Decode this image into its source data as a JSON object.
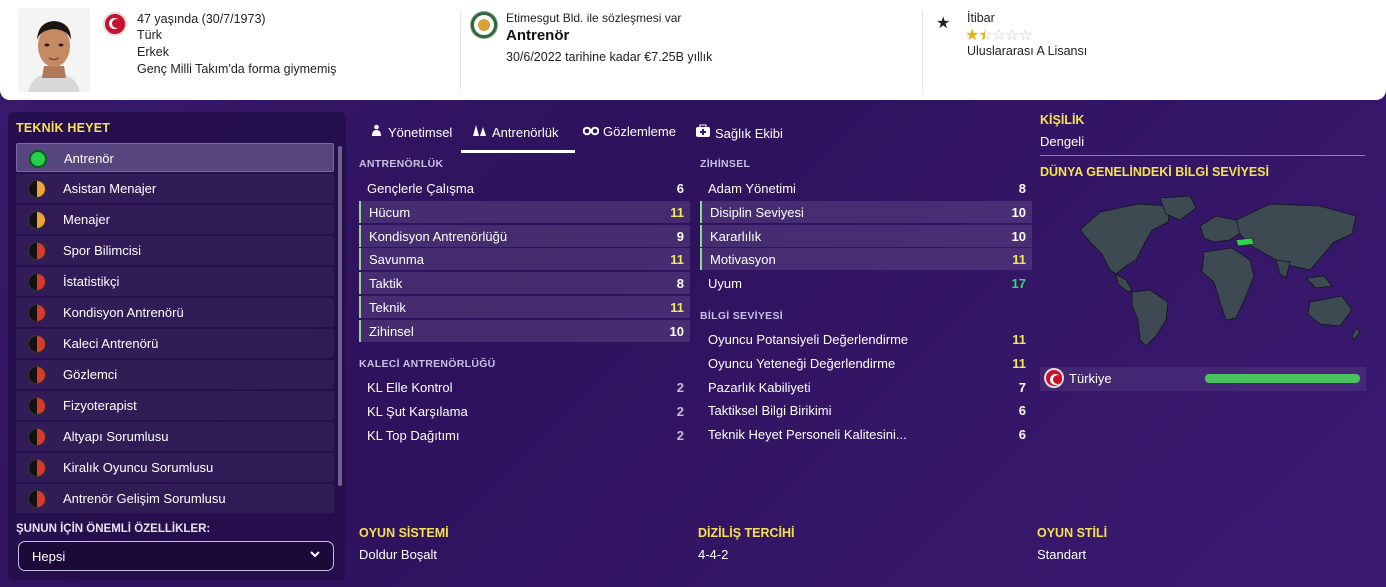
{
  "header": {
    "age_line": "47 yaşında (30/7/1973)",
    "nationality": "Türk",
    "gender": "Erkek",
    "caps_line": "Genç Milli Takım'da forma giymemiş",
    "contract_line": "Etimesgut Bld. ile sözleşmesi var",
    "role": "Antrenör",
    "contract_detail": "30/6/2022 tarihine kadar €7.25B yıllık",
    "reputation_label": "İtibar",
    "reputation_stars": 1.5,
    "reputation_max": 5,
    "license": "Uluslararası A Lisansı",
    "reputation_icon": "star-icon"
  },
  "staff_panel": {
    "title": "TEKNİK HEYET",
    "items": [
      {
        "label": "Antrenör",
        "status": "green"
      },
      {
        "label": "Asistan Menajer",
        "status": "orange"
      },
      {
        "label": "Menajer",
        "status": "orange"
      },
      {
        "label": "Spor Bilimcisi",
        "status": "red"
      },
      {
        "label": "İstatistikçi",
        "status": "red"
      },
      {
        "label": "Kondisyon Antrenörü",
        "status": "red"
      },
      {
        "label": "Kaleci Antrenörü",
        "status": "red"
      },
      {
        "label": "Gözlemci",
        "status": "red"
      },
      {
        "label": "Fizyoterapist",
        "status": "red"
      },
      {
        "label": "Altyapı Sorumlusu",
        "status": "red"
      },
      {
        "label": "Kiralık Oyuncu Sorumlusu",
        "status": "red"
      },
      {
        "label": "Antrenör Gelişim Sorumlusu",
        "status": "red"
      }
    ],
    "filter_label": "ŞUNUN İÇİN ÖNEMLİ ÖZELLİKLER:",
    "filter_value": "Hepsi"
  },
  "tabs": [
    {
      "label": "Yönetimsel",
      "icon": "people-icon"
    },
    {
      "label": "Antrenörlük",
      "icon": "cones-icon",
      "active": true
    },
    {
      "label": "Gözlemleme",
      "icon": "binoculars-icon"
    },
    {
      "label": "Sağlık Ekibi",
      "icon": "medical-kit-icon"
    }
  ],
  "coaching": {
    "title": "ANTRENÖRLÜK",
    "rows": [
      {
        "name": "Gençlerle Çalışma",
        "value": "6",
        "hl": false,
        "color": "w"
      },
      {
        "name": "Hücum",
        "value": "11",
        "hl": true,
        "color": "y"
      },
      {
        "name": "Kondisyon Antrenörlüğü",
        "value": "9",
        "hl": true,
        "color": "w"
      },
      {
        "name": "Savunma",
        "value": "11",
        "hl": true,
        "color": "y"
      },
      {
        "name": "Taktik",
        "value": "8",
        "hl": true,
        "color": "w"
      },
      {
        "name": "Teknik",
        "value": "11",
        "hl": true,
        "color": "y"
      },
      {
        "name": "Zihinsel",
        "value": "10",
        "hl": true,
        "color": "w"
      }
    ]
  },
  "goalkeeping": {
    "title": "KALECİ ANTRENÖRLÜĞÜ",
    "rows": [
      {
        "name": "KL Elle Kontrol",
        "value": "2",
        "color": "dim"
      },
      {
        "name": "KL Şut Karşılama",
        "value": "2",
        "color": "dim"
      },
      {
        "name": "KL Top Dağıtımı",
        "value": "2",
        "color": "dim"
      }
    ]
  },
  "mental": {
    "title": "ZİHİNSEL",
    "rows": [
      {
        "name": "Adam Yönetimi",
        "value": "8",
        "hl": false,
        "color": "w"
      },
      {
        "name": "Disiplin Seviyesi",
        "value": "10",
        "hl": true,
        "color": "w"
      },
      {
        "name": "Kararlılık",
        "value": "10",
        "hl": true,
        "color": "w"
      },
      {
        "name": "Motivasyon",
        "value": "11",
        "hl": true,
        "color": "y"
      },
      {
        "name": "Uyum",
        "value": "17",
        "hl": false,
        "color": "g"
      }
    ]
  },
  "knowledge": {
    "title": "BİLGİ SEVİYESİ",
    "rows": [
      {
        "name": "Oyuncu Potansiyeli Değerlendirme",
        "value": "11",
        "color": "y"
      },
      {
        "name": "Oyuncu Yeteneği Değerlendirme",
        "value": "11",
        "color": "y"
      },
      {
        "name": "Pazarlık Kabiliyeti",
        "value": "7",
        "color": "w"
      },
      {
        "name": "Taktiksel Bilgi Birikimi",
        "value": "6",
        "color": "w"
      },
      {
        "name": "Teknik Heyet Personeli Kalitesini...",
        "value": "6",
        "color": "w"
      }
    ]
  },
  "personality": {
    "title": "KİŞİLİK",
    "value": "Dengeli"
  },
  "world_knowledge": {
    "title": "DÜNYA GENELİNDEKİ BİLGİ SEVİYESİ",
    "country": "Türkiye",
    "level": 1.0
  },
  "bottom": {
    "system_title": "OYUN SİSTEMİ",
    "system_value": "Doldur Boşalt",
    "formation_title": "DİZİLİŞ TERCİHİ",
    "formation_value": "4-4-2",
    "style_title": "OYUN STİLİ",
    "style_value": "Standart"
  },
  "colors": {
    "accent_yellow": "#f4e34b",
    "good_green": "#2fe06a",
    "highlight_value": "#f1e85a",
    "background": "#3a1a6e"
  }
}
